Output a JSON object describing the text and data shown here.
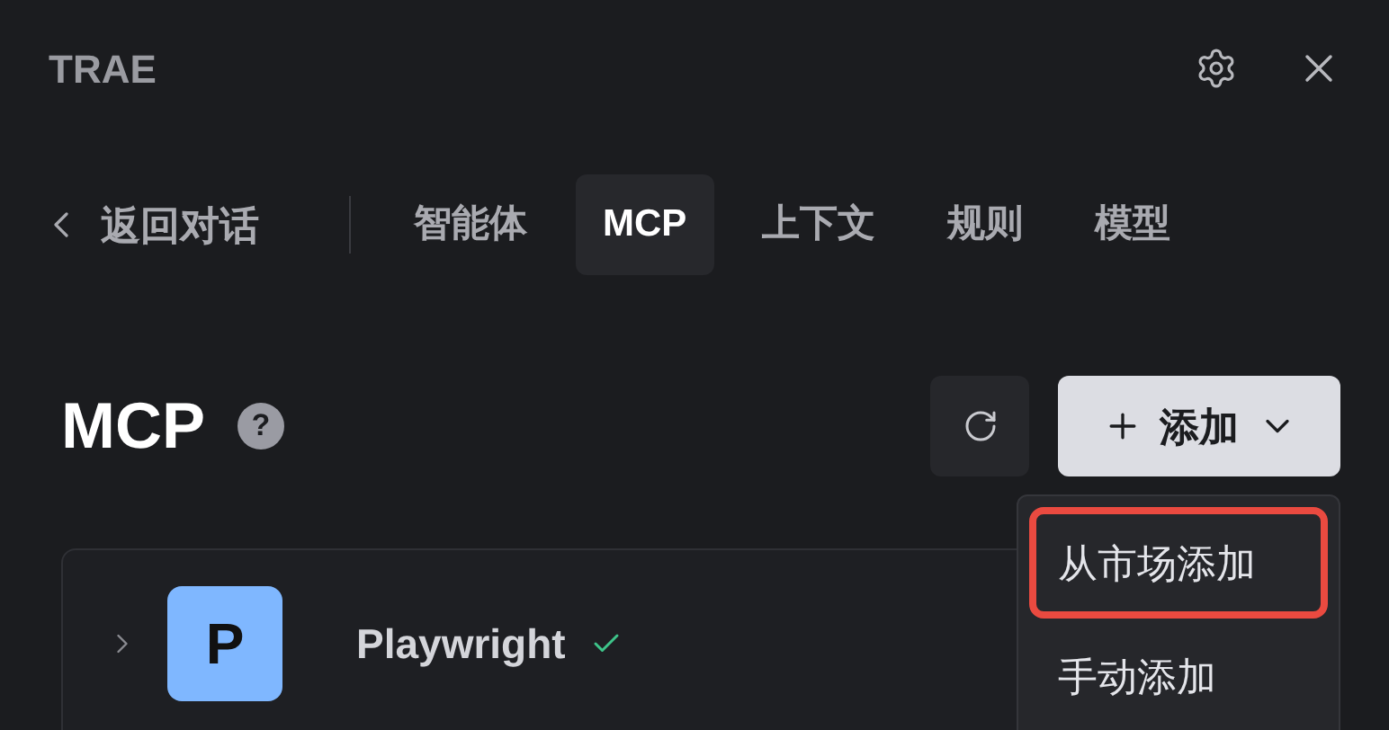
{
  "window": {
    "title": "TRAE"
  },
  "back": {
    "label": "返回对话"
  },
  "tabs": [
    {
      "label": "智能体",
      "selected": false
    },
    {
      "label": "MCP",
      "selected": true
    },
    {
      "label": "上下文",
      "selected": false
    },
    {
      "label": "规则",
      "selected": false
    },
    {
      "label": "模型",
      "selected": false
    }
  ],
  "section": {
    "title": "MCP",
    "help": "?",
    "add_label": "添加"
  },
  "add_menu": {
    "open": true,
    "items": [
      {
        "label": "从市场添加",
        "highlighted": true
      },
      {
        "label": "手动添加",
        "highlighted": false
      }
    ]
  },
  "servers": [
    {
      "letter": "P",
      "name": "Playwright",
      "expanded": false,
      "connected": true
    }
  ]
}
